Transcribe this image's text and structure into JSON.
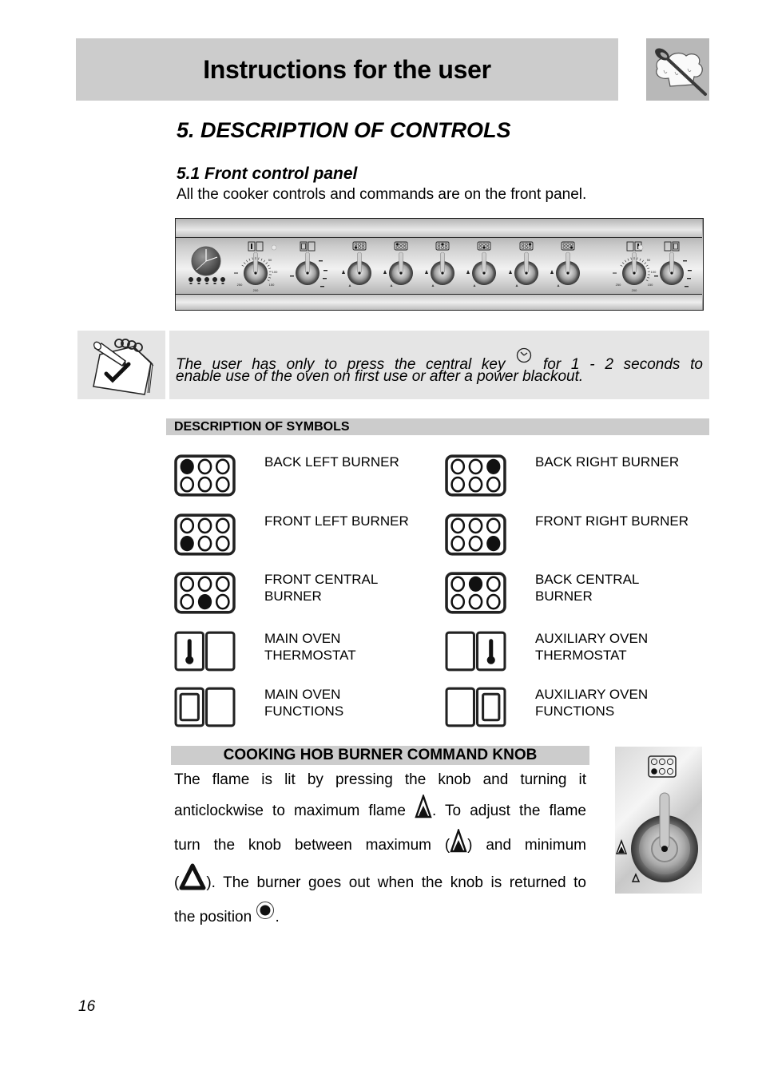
{
  "header": {
    "title": "Instructions for the user",
    "logo_icon": "chef-hat-spoon-icon"
  },
  "section": {
    "title": "5.  DESCRIPTION OF CONTROLS",
    "subsection_title": "5.1 Front control panel",
    "intro": "All the cooker controls and commands are on the front panel."
  },
  "control_panel": {
    "thermostat_scale": [
      "50",
      "100",
      "150",
      "200",
      "250"
    ],
    "knobs": [
      {
        "id": "clock",
        "label": "clock"
      },
      {
        "id": "main-oven-thermostat",
        "symbol": "main-oven-thermostat"
      },
      {
        "id": "main-oven-functions",
        "symbol": "main-oven-functions"
      },
      {
        "id": "burner-1",
        "symbol": "front-left"
      },
      {
        "id": "burner-2",
        "symbol": "back-left"
      },
      {
        "id": "burner-3",
        "symbol": "back-central"
      },
      {
        "id": "burner-4",
        "symbol": "front-central"
      },
      {
        "id": "burner-5",
        "symbol": "back-right"
      },
      {
        "id": "burner-6",
        "symbol": "front-right"
      },
      {
        "id": "aux-oven-thermostat",
        "symbol": "auxiliary-oven-thermostat"
      },
      {
        "id": "aux-oven-functions",
        "symbol": "auxiliary-oven-functions"
      }
    ],
    "clock_buttons": [
      "bell",
      "hand",
      "clock",
      "−",
      "+"
    ]
  },
  "note": {
    "icon": "notepad-check-icon",
    "line1_before": "The user has only to press the central key",
    "key_icon": "clock-key-icon",
    "line1_after": "for 1 - 2 seconds to",
    "line2": "enable use of the oven on first use or after a power blackout."
  },
  "symbols": {
    "header": "DESCRIPTION OF SYMBOLS",
    "items": [
      {
        "icon": "back-left-burner-icon",
        "label": "BACK LEFT BURNER"
      },
      {
        "icon": "back-right-burner-icon",
        "label": "BACK RIGHT BURNER"
      },
      {
        "icon": "front-left-burner-icon",
        "label": "FRONT LEFT BURNER"
      },
      {
        "icon": "front-right-burner-icon",
        "label": "FRONT RIGHT BURNER"
      },
      {
        "icon": "front-central-burner-icon",
        "label_l1": "FRONT CENTRAL",
        "label_l2": "BURNER"
      },
      {
        "icon": "back-central-burner-icon",
        "label_l1": "BACK CENTRAL",
        "label_l2": "BURNER"
      },
      {
        "icon": "main-oven-thermostat-icon",
        "label_l1": "MAIN OVEN",
        "label_l2": "THERMOSTAT"
      },
      {
        "icon": "auxiliary-oven-thermostat-icon",
        "label_l1": "AUXILIARY OVEN",
        "label_l2": "THERMOSTAT"
      },
      {
        "icon": "main-oven-functions-icon",
        "label_l1": "MAIN OVEN",
        "label_l2": "FUNCTIONS"
      },
      {
        "icon": "auxiliary-oven-functions-icon",
        "label_l1": "AUXILIARY OVEN",
        "label_l2": "FUNCTIONS"
      }
    ]
  },
  "knob_section": {
    "header": "COOKING HOB BURNER COMMAND KNOB",
    "l1": "The flame is lit by pressing the knob and turning it",
    "l2a": "anticlockwise to maximum flame",
    "l2b": ". To adjust the flame",
    "l3a": "turn the knob between maximum (",
    "l3b": ") and minimum",
    "l4a": "(",
    "l4b": "). The burner goes out when the knob is returned to",
    "l5a": "the position",
    "l5b": ".",
    "icons": [
      "max-flame-icon",
      "min-flame-icon",
      "off-position-icon"
    ]
  },
  "page_number": "16"
}
